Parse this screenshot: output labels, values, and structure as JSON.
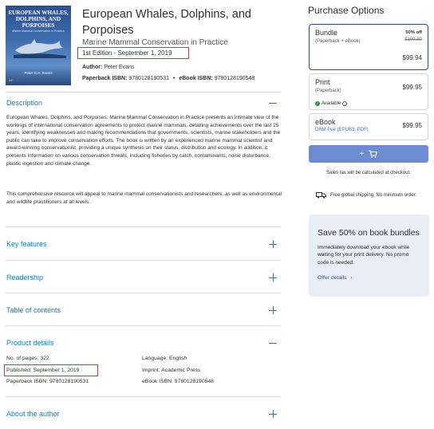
{
  "book": {
    "title": "European Whales, Dolphins, and Porpoises",
    "subtitle": "Marine Mammal Conservation in Practice",
    "edition": "1st Edition - September 1, 2019",
    "author_label": "Author:",
    "author": "Peter Evans",
    "paperback_label": "Paperback ISBN:",
    "paperback_isbn": "9780128190531",
    "bullet": "•",
    "ebook_label": "eBook ISBN:",
    "ebook_isbn": "9780128190548"
  },
  "cover": {
    "title": "EUROPEAN WHALES, DOLPHINS, AND PORPOISES",
    "subtitle": "Marine Mammal Conservation in Practice",
    "author": "Peter G.H. Evans",
    "publisher": "AP"
  },
  "sections": {
    "description": "Description",
    "key_features": "Key features",
    "readership": "Readership",
    "toc": "Table of contents",
    "product_details": "Product details",
    "about_author": "About the author"
  },
  "description": {
    "p1": "European Whales, Dolphins, and Porpoises: Marine Mammal Conservation in Practice presents an intimate view of the workings of international conservation agreements to protect marine mammals, detailing achievements over the last 25 years, identifying weaknesses and making recommendations that governments, scientists, marine stakeholders and the public can take to improve conservation efforts. The book is written by an experienced marine mammal scientist and award-winning conservationist, providing a unique synthesis on their status, distribution and ecology. In addition, it presents information on various conservation threats, including fisheries by catch, contaminants, noise disturbance, plastic ingestion and climate change.",
    "p2": "This comprehensive resource will appeal to marine mammal conservationists and researchers, as well as environmental and wildlife practitioners at all levels."
  },
  "product_details": {
    "pages": "No. of pages: 322",
    "language": "Language: English",
    "published": "Published: September 1, 2019",
    "imprint": "Imprint: Academic Press",
    "paperback": "Paperback ISBN: 9780128190531",
    "ebook": "eBook ISBN: 9780128190548"
  },
  "purchase": {
    "title": "Purchase Options",
    "bundle": {
      "name": "Bundle",
      "desc": "(Paperback + eBook)",
      "discount": "50% off",
      "old_price": "$199.90",
      "price": "$99.94"
    },
    "print": {
      "name": "Print",
      "desc": "(Paperback)",
      "availability": "Available",
      "price": "$99.95"
    },
    "ebook": {
      "name": "eBook",
      "desc": "DRM-free (EPUB3, PDF)",
      "price": "$99.95"
    },
    "cart_plus": "+",
    "tax_note": "Sales tax will be calculated at checkout.",
    "shipping_note": "Free global shipping. No minimum order."
  },
  "promo": {
    "heading": "Save 50% on book bundles",
    "text": "Immediately download your ebook while waiting for your print delivery. No promo code is needed.",
    "link": "Offer details",
    "link_arrow": "›"
  },
  "colors": {
    "accent": "#0c7dbb",
    "selected_border": "#2c4b86",
    "cart_button": "#6d8bd1",
    "highlight": "#d3343b",
    "promo_bg": "#e8edf6"
  }
}
